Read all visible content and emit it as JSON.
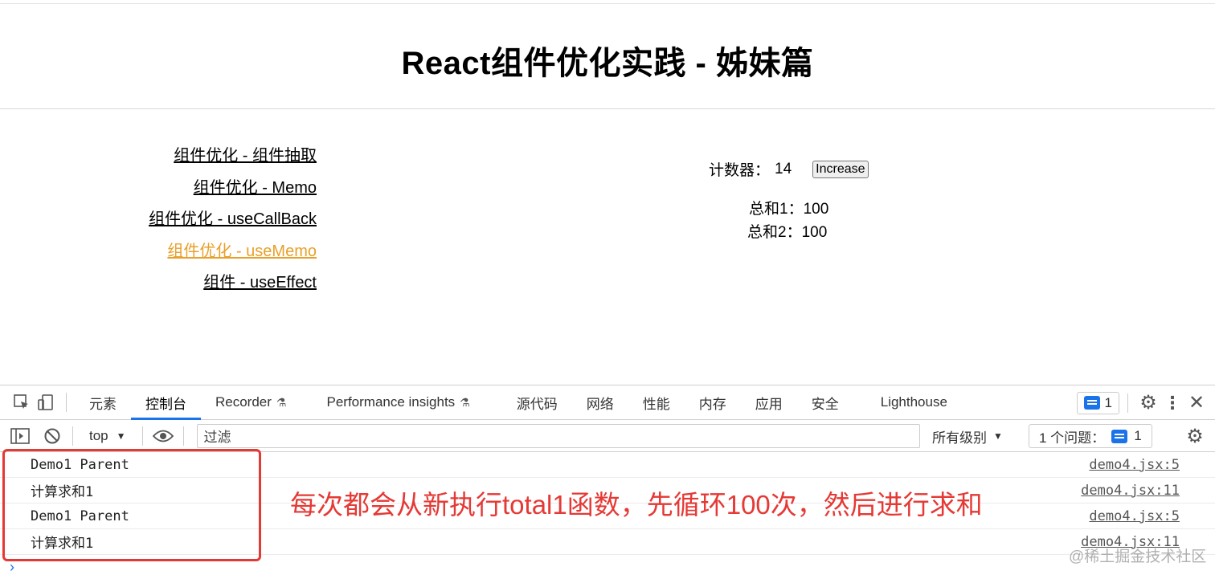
{
  "page": {
    "title": "React组件优化实践 - 姊妹篇",
    "nav_links": [
      {
        "label": "组件优化 - 组件抽取",
        "active": false
      },
      {
        "label": "组件优化 - Memo",
        "active": false
      },
      {
        "label": "组件优化 - useCallBack",
        "active": false
      },
      {
        "label": "组件优化 - useMemo",
        "active": true
      },
      {
        "label": "组件 - useEffect",
        "active": false
      }
    ],
    "counter_label": "计数器：",
    "counter_value": "14",
    "increase_button": "Increase",
    "sum1": "总和1：100",
    "sum2": "总和2：100"
  },
  "devtools": {
    "tabs": [
      "元素",
      "控制台",
      "Recorder",
      "Performance insights",
      "源代码",
      "网络",
      "性能",
      "内存",
      "应用",
      "安全",
      "Lighthouse"
    ],
    "active_tab": "控制台",
    "issue_badge_count": "1",
    "context": "top",
    "filter_placeholder": "过滤",
    "levels": "所有级别",
    "issues_label": "1 个问题：",
    "issues_count": "1",
    "logs": [
      {
        "message": "Demo1 Parent",
        "source": "demo4.jsx:5"
      },
      {
        "message": "计算求和1",
        "source": "demo4.jsx:11"
      },
      {
        "message": "Demo1 Parent",
        "source": "demo4.jsx:5"
      },
      {
        "message": "计算求和1",
        "source": "demo4.jsx:11"
      }
    ]
  },
  "annotation": "每次都会从新执行total1函数，先循环100次，然后进行求和",
  "watermark": "@稀土掘金技术社区",
  "colors": {
    "accent": "#1a73e8",
    "active_link": "#e8a02a",
    "annotation": "#e53935"
  }
}
